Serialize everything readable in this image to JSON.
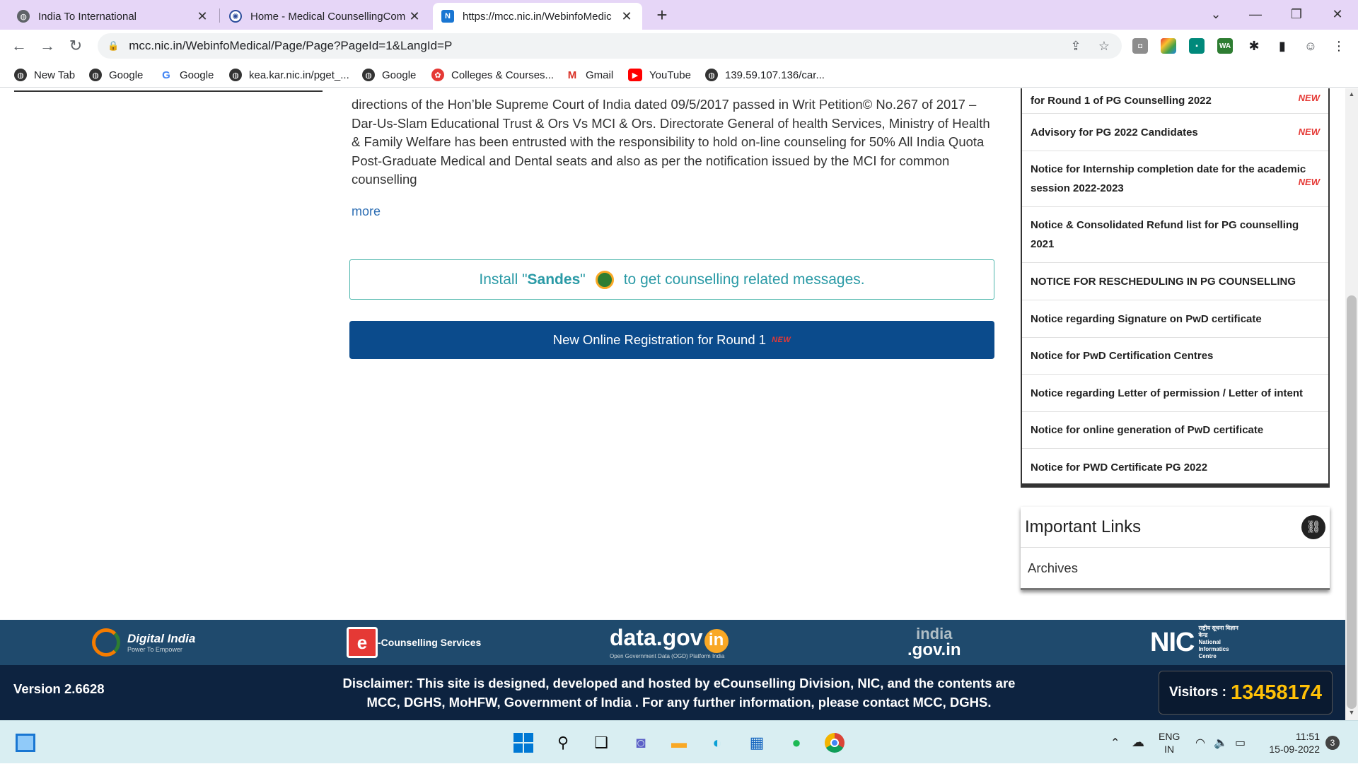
{
  "browser": {
    "tabs": [
      {
        "title": "India To International",
        "favicon": "globe-icon"
      },
      {
        "title": "Home - Medical CounsellingCom",
        "favicon": "emblem-icon"
      },
      {
        "title": "https://mcc.nic.in/WebinfoMedic",
        "favicon": "nic-icon"
      }
    ],
    "new_tab_glyph": "+",
    "address": {
      "url": "mcc.nic.in/WebinfoMedical/Page/Page?PageId=1&LangId=P"
    },
    "bookmarks": [
      {
        "label": "New Tab"
      },
      {
        "label": "Google"
      },
      {
        "label": "Google"
      },
      {
        "label": "kea.kar.nic.in/pget_..."
      },
      {
        "label": "Google"
      },
      {
        "label": "Colleges & Courses..."
      },
      {
        "label": "Gmail"
      },
      {
        "label": "YouTube"
      },
      {
        "label": "139.59.107.136/car..."
      }
    ]
  },
  "main": {
    "intro_text": "directions of the Hon’ble Supreme Court of India dated 09/5/2017 passed in Writ Petition© No.267 of 2017 – Dar-Us-Slam Educational Trust & Ors Vs MCI & Ors. Directorate General of health Services, Ministry of Health & Family Welfare has been entrusted with the responsibility to hold on-line counseling for 50% All India Quota Post-Graduate Medical and Dental seats and also as per the notification issued by the MCI for common counselling",
    "more_link": "more",
    "sandes": {
      "prefix": "Install \"",
      "brand": "Sandes",
      "suffix": "\"",
      "message": "to get counselling related messages."
    },
    "registration_button": "New Online Registration for Round 1",
    "new_badge": "NEW"
  },
  "notices": [
    {
      "text": "for Round 1 of PG Counselling 2022",
      "is_new": true
    },
    {
      "text": "Advisory for PG 2022 Candidates",
      "is_new": true
    },
    {
      "text": "Notice for Internship completion date for the academic session 2022-2023",
      "is_new": true
    },
    {
      "text": "Notice & Consolidated Refund list for PG counselling 2021",
      "is_new": false
    },
    {
      "text": "NOTICE FOR RESCHEDULING IN PG COUNSELLING",
      "is_new": false
    },
    {
      "text": "Notice regarding Signature on PwD certificate",
      "is_new": false
    },
    {
      "text": "Notice for PwD Certification Centres",
      "is_new": false
    },
    {
      "text": "Notice regarding Letter of permission / Letter of intent",
      "is_new": false
    },
    {
      "text": "Notice for online generation of PwD certificate",
      "is_new": false
    },
    {
      "text": "Notice for PWD Certificate PG 2022",
      "is_new": false
    }
  ],
  "important_links": {
    "title": "Important Links",
    "items": [
      "Archives"
    ]
  },
  "footer": {
    "logos": {
      "digital_india": "Digital India",
      "digital_india_tagline": "Power To Empower",
      "ecounselling": "-Counselling Services",
      "datagov": "data.gov",
      "datagov_in": "in",
      "datagov_tagline": "Open Government Data (OGD) Platform India",
      "indiagov_top": "india",
      "indiagov_bottom": ".gov.in",
      "nic": "NIC",
      "nic_hindi": "राष्ट्रीय सूचना विज्ञान केन्द्र",
      "nic_full": "National Informatics Centre"
    },
    "version": "Version 2.6628",
    "disclaimer": "Disclaimer: This site is designed, developed and hosted by eCounselling Division, NIC, and the contents are MCC, DGHS, MoHFW, Government of India . For any further information, please contact MCC, DGHS.",
    "visitors_label": "Visitors :",
    "visitors_count": "13458174"
  },
  "taskbar": {
    "lang_top": "ENG",
    "lang_bottom": "IN",
    "time": "11:51",
    "date": "15-09-2022",
    "notification_count": "3"
  },
  "colors": {
    "tabstrip": "#e6d6f7",
    "primary_button": "#0b4b8c",
    "footer_logos_bg": "#1f4a6d",
    "footer_bg": "#0d2340",
    "visitor_count": "#ffc107",
    "sandes_teal": "#2a9aa6"
  }
}
